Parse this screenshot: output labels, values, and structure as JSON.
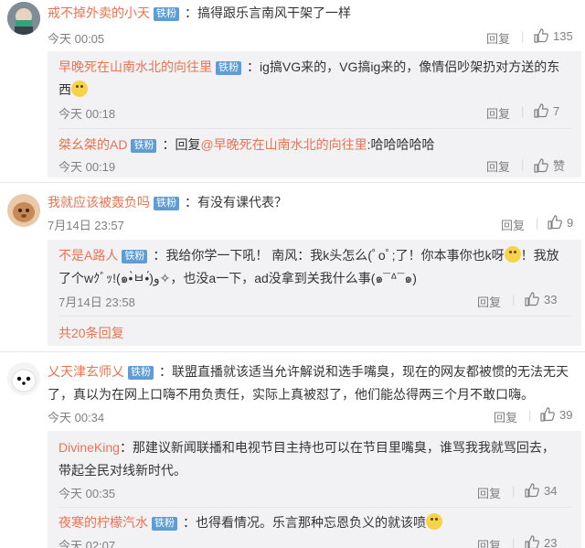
{
  "badge": "铁粉",
  "reply_label": "回复",
  "c1": {
    "name": "戒不掉外卖的小天",
    "text": "：搞得跟乐言南风干架了一样",
    "time": "今天 00:05",
    "likes": "135"
  },
  "c1r1": {
    "name": "早晚死在山南水北的向往里",
    "text1": "：ig搞VG来的，VG搞ig来的，像情侣吵架扔对方送的东",
    "text2": "西",
    "time": "今天 00:18",
    "likes": "7"
  },
  "c1r2": {
    "name": "桀幺桀的AD",
    "text_pre": "：回复",
    "mention": "@早晚死在山南水北的向往里",
    "text_post": ":哈哈哈哈哈",
    "time": "今天 00:19",
    "likes": "赞"
  },
  "c2": {
    "name": "我就应该被轰负吗",
    "text": "：有没有课代表？",
    "time": "7月14日 23:57",
    "likes": "9"
  },
  "c2r1": {
    "name": "不是A路人",
    "text1": "：我给你学一下吼！ 南风：我k头怎么(ﾟoﾟ;了！你本事你也k呀",
    "text1b": "！我放",
    "text2": "了个wｸﾞｯ!(๑•̀ㅂ•́)و✧，也没a一下，ad没拿到关我什么事(๑¯ᐞ¯๑)",
    "time": "7月14日 23:58",
    "likes": "33"
  },
  "c2_more": "共20条回复",
  "c3": {
    "name": "乂天津玄师乂",
    "text1": "：联盟直播就该适当允许解说和选手嘴臭，现在的网友都被惯的无法无天",
    "text2": "了，真以为在网上口嗨不用负责任，实际上真被怼了，他们能怂得两三个月不敢口嗨。",
    "time": "今天 00:34",
    "likes": "39"
  },
  "c3r1": {
    "name": "DivineKing",
    "text1": "：那建议新闻联播和电视节目主持也可以在节目里嘴臭，谁骂我我就骂回去，",
    "text2": "带起全民对线新时代。",
    "time": "今天 00:35",
    "likes": "34"
  },
  "c3r2": {
    "name": "夜寒的柠檬汽水",
    "text": "：也得看情况。乐言那种忘恩负义的就该喷",
    "time": "今天 02:07",
    "likes": "23"
  }
}
